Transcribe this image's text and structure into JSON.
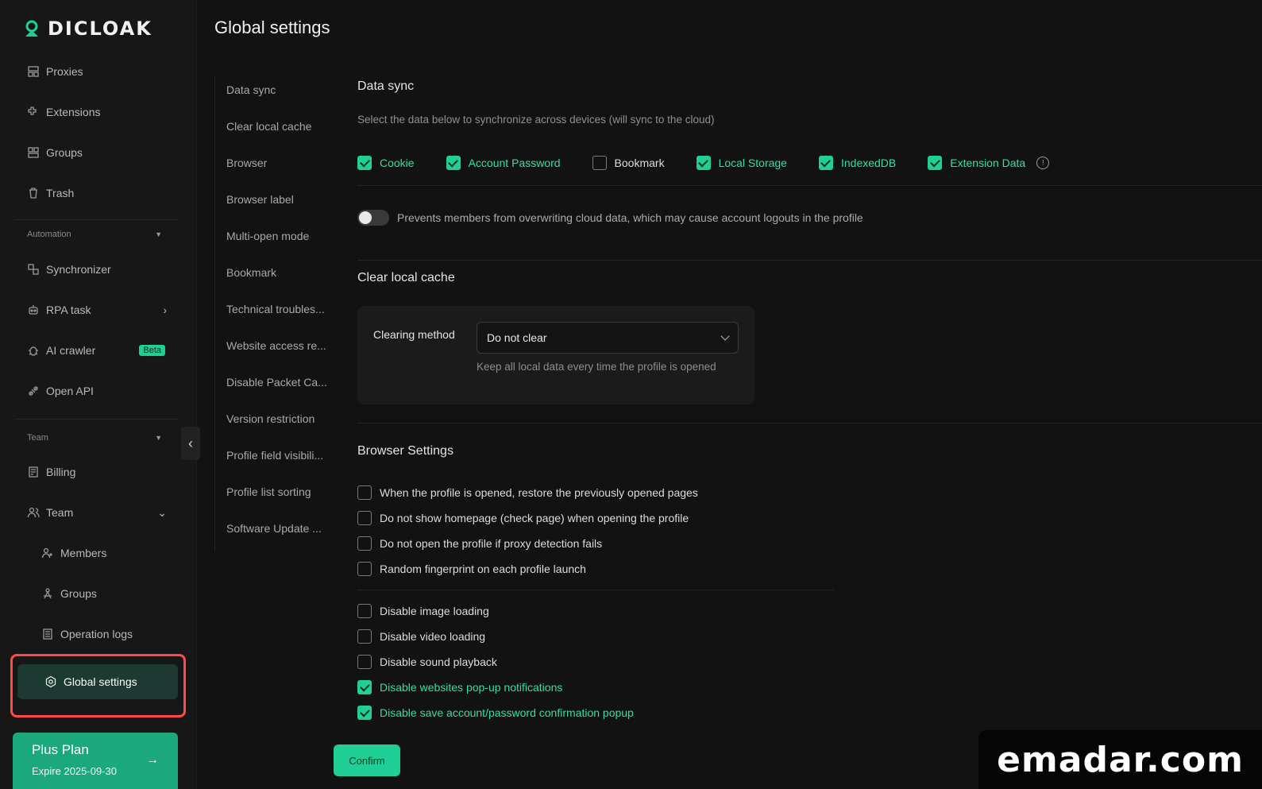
{
  "brand": {
    "name": "DICLOAK"
  },
  "sidebar": {
    "top_items": [
      {
        "label": "Proxies",
        "icon": "proxies-icon"
      },
      {
        "label": "Extensions",
        "icon": "extensions-icon"
      },
      {
        "label": "Groups",
        "icon": "groups-icon"
      },
      {
        "label": "Trash",
        "icon": "trash-icon"
      }
    ],
    "automation_label": "Automation",
    "automation_items": [
      {
        "label": "Synchronizer",
        "icon": "synchronizer-icon"
      },
      {
        "label": "RPA task",
        "icon": "robot-icon"
      },
      {
        "label": "AI crawler",
        "icon": "bug-icon",
        "badge": "Beta"
      },
      {
        "label": "Open API",
        "icon": "api-icon"
      }
    ],
    "team_label": "Team",
    "team_items": [
      {
        "label": "Billing",
        "icon": "billing-icon"
      },
      {
        "label": "Team",
        "icon": "team-icon"
      },
      {
        "label": "Members",
        "icon": "members-icon"
      },
      {
        "label": "Groups",
        "icon": "team-groups-icon"
      },
      {
        "label": "Operation logs",
        "icon": "logs-icon"
      },
      {
        "label": "Global settings",
        "icon": "settings-icon"
      }
    ],
    "plan": {
      "title": "Plus Plan",
      "expire": "Expire 2025-09-30"
    }
  },
  "page": {
    "title": "Global settings"
  },
  "anchors": [
    "Data sync",
    "Clear local cache",
    "Browser",
    "Browser label",
    "Multi-open mode",
    "Bookmark",
    "Technical troubles...",
    "Website access re...",
    "Disable Packet Ca...",
    "Version restriction",
    "Profile field visibili...",
    "Profile list sorting",
    "Software Update ..."
  ],
  "data_sync": {
    "title": "Data sync",
    "description": "Select the data below to synchronize across devices (will sync to the cloud)",
    "options": [
      {
        "label": "Cookie",
        "checked": true
      },
      {
        "label": "Account Password",
        "checked": true
      },
      {
        "label": "Bookmark",
        "checked": false
      },
      {
        "label": "Local Storage",
        "checked": true
      },
      {
        "label": "IndexedDB",
        "checked": true
      },
      {
        "label": "Extension Data",
        "checked": true
      }
    ],
    "toggle_label": "Prevents members from overwriting cloud data, which may cause account logouts in the profile",
    "toggle_on": false
  },
  "cache": {
    "title": "Clear local cache",
    "method_label": "Clearing method",
    "selected": "Do not clear",
    "help": "Keep all local data every time the profile is opened"
  },
  "browser_settings": {
    "title": "Browser Settings",
    "group1": [
      {
        "label": "When the profile is opened, restore the previously opened pages",
        "checked": false
      },
      {
        "label": "Do not show homepage (check page) when opening the profile",
        "checked": false
      },
      {
        "label": "Do not open the profile if proxy detection fails",
        "checked": false
      },
      {
        "label": "Random fingerprint on each profile launch",
        "checked": false
      }
    ],
    "group2": [
      {
        "label": "Disable image loading",
        "checked": false
      },
      {
        "label": "Disable video loading",
        "checked": false
      },
      {
        "label": "Disable sound playback",
        "checked": false
      },
      {
        "label": "Disable websites pop-up notifications",
        "checked": true
      },
      {
        "label": "Disable save account/password confirmation popup",
        "checked": true
      }
    ]
  },
  "actions": {
    "confirm": "Confirm"
  },
  "watermark": "emadar.com"
}
